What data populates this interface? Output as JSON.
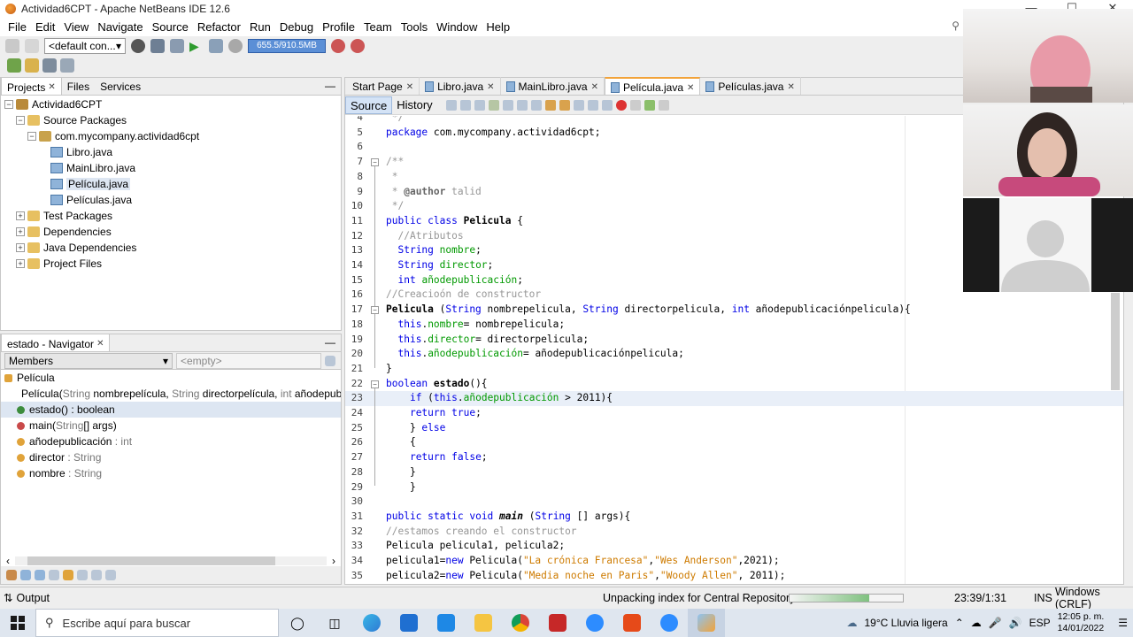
{
  "window": {
    "title": "Actividad6CPT - Apache NetBeans IDE 12.6",
    "min": "—",
    "max": "☐",
    "close": "✕"
  },
  "menu": [
    "File",
    "Edit",
    "View",
    "Navigate",
    "Source",
    "Refactor",
    "Run",
    "Debug",
    "Profile",
    "Team",
    "Tools",
    "Window",
    "Help"
  ],
  "toolbar": {
    "config": "<default con...",
    "memory": "655.5/910.5MB"
  },
  "projects_pane": {
    "tabs": [
      {
        "label": "Projects",
        "active": true
      },
      {
        "label": "Files"
      },
      {
        "label": "Services"
      }
    ],
    "tree": [
      {
        "label": "Actividad6CPT",
        "level": 0,
        "toggle": "−",
        "icon": "project"
      },
      {
        "label": "Source Packages",
        "level": 1,
        "toggle": "−",
        "icon": "folder"
      },
      {
        "label": "com.mycompany.actividad6cpt",
        "level": 2,
        "toggle": "−",
        "icon": "package"
      },
      {
        "label": "Libro.java",
        "level": 3,
        "icon": "file"
      },
      {
        "label": "MainLibro.java",
        "level": 3,
        "icon": "file"
      },
      {
        "label": "Película.java",
        "level": 3,
        "icon": "file",
        "selected": true
      },
      {
        "label": "Películas.java",
        "level": 3,
        "icon": "file"
      },
      {
        "label": "Test Packages",
        "level": 1,
        "toggle": "+",
        "icon": "folder"
      },
      {
        "label": "Dependencies",
        "level": 1,
        "toggle": "+",
        "icon": "folder"
      },
      {
        "label": "Java Dependencies",
        "level": 1,
        "toggle": "+",
        "icon": "folder"
      },
      {
        "label": "Project Files",
        "level": 1,
        "toggle": "+",
        "icon": "folder"
      }
    ]
  },
  "navigator": {
    "tab": "estado - Navigator",
    "filter": "Members",
    "empty": "<empty>",
    "root": "Película",
    "members": [
      {
        "name": "Película(",
        "type": "String",
        "rest": " nombrepelícula, ",
        "type2": "String",
        "rest2": " directorpelícula, ",
        "type3": "int",
        "rest3": " añodepub",
        "color": "#e0a33a"
      },
      {
        "name": "estado() : boolean",
        "color": "#3c8c3c",
        "selected": true
      },
      {
        "name": "main(",
        "type": "String",
        "rest": "[] args)",
        "color": "#c94a4a"
      },
      {
        "name": "añodepublicación",
        "type": " : int",
        "color": "#e0a33a"
      },
      {
        "name": "director",
        "type": " : String",
        "color": "#e0a33a"
      },
      {
        "name": "nombre",
        "type": " : String",
        "color": "#e0a33a"
      }
    ]
  },
  "editor_tabs": [
    {
      "label": "Start Page"
    },
    {
      "label": "Libro.java"
    },
    {
      "label": "MainLibro.java"
    },
    {
      "label": "Película.java",
      "active": true
    },
    {
      "label": "Películas.java"
    }
  ],
  "source_bar": {
    "source": "Source",
    "history": "History"
  },
  "code": [
    {
      "n": "4",
      "t": " */"
    },
    {
      "n": "5",
      "t": "package com.mycompany.actividad6cpt;"
    },
    {
      "n": "6",
      "t": ""
    },
    {
      "n": "7",
      "t": "/**"
    },
    {
      "n": "8",
      "t": " *"
    },
    {
      "n": "9",
      "t": " * @author talid"
    },
    {
      "n": "10",
      "t": " */"
    },
    {
      "n": "11",
      "t": "public class Pelicula {"
    },
    {
      "n": "12",
      "t": "  //Atributos"
    },
    {
      "n": "13",
      "t": "  String nombre;"
    },
    {
      "n": "14",
      "t": "  String director;"
    },
    {
      "n": "15",
      "t": "  int añodepublicación;"
    },
    {
      "n": "16",
      "t": "//Creacioón de constructor"
    },
    {
      "n": "17",
      "t": "Pelicula (String nombrepelicula, String directorpelicula, int añodepublicaciónpelicula){"
    },
    {
      "n": "18",
      "t": "  this.nombre= nombrepelicula;"
    },
    {
      "n": "19",
      "t": "  this.director= directorpelicula;"
    },
    {
      "n": "20",
      "t": "  this.añodepublicación= añodepublicaciónpelicula;"
    },
    {
      "n": "21",
      "t": "}"
    },
    {
      "n": "22",
      "t": "boolean estado(){"
    },
    {
      "n": "23",
      "t": "    if (this.añodepublicación > 2011){",
      "current": true
    },
    {
      "n": "24",
      "t": "    return true;"
    },
    {
      "n": "25",
      "t": "    } else"
    },
    {
      "n": "26",
      "t": "    {"
    },
    {
      "n": "27",
      "t": "    return false;"
    },
    {
      "n": "28",
      "t": "    }"
    },
    {
      "n": "29",
      "t": "    }"
    },
    {
      "n": "30",
      "t": ""
    },
    {
      "n": "31",
      "t": "public static void main (String [] args){"
    },
    {
      "n": "32",
      "t": "//estamos creando el constructor"
    },
    {
      "n": "33",
      "t": "Pelicula pelicula1, pelicula2;"
    },
    {
      "n": "34",
      "t": "pelicula1=new Pelicula(\"La crónica Francesa\",\"Wes Anderson\",2021);"
    },
    {
      "n": "35",
      "t": "pelicula2=new Pelicula(\"Media noche en Paris\",\"Woody Allen\", 2011);"
    }
  ],
  "status": {
    "output": "Output",
    "task": "Unpacking index for Central Repository",
    "progress": 0.7,
    "position": "23:39/1:31",
    "ins": "INS",
    "os": "Windows (CRLF)"
  },
  "taskbar": {
    "search_placeholder": "Escribe aquí para buscar",
    "weather": "19°C  Lluvia ligera",
    "lang": "ESP",
    "time": "12:05 p. m.",
    "date": "14/01/2022"
  },
  "colors": {
    "keyword": "#0000e6",
    "comment": "#969696",
    "field": "#009900",
    "string": "#ce7b00",
    "accent": "#f2a33a"
  }
}
